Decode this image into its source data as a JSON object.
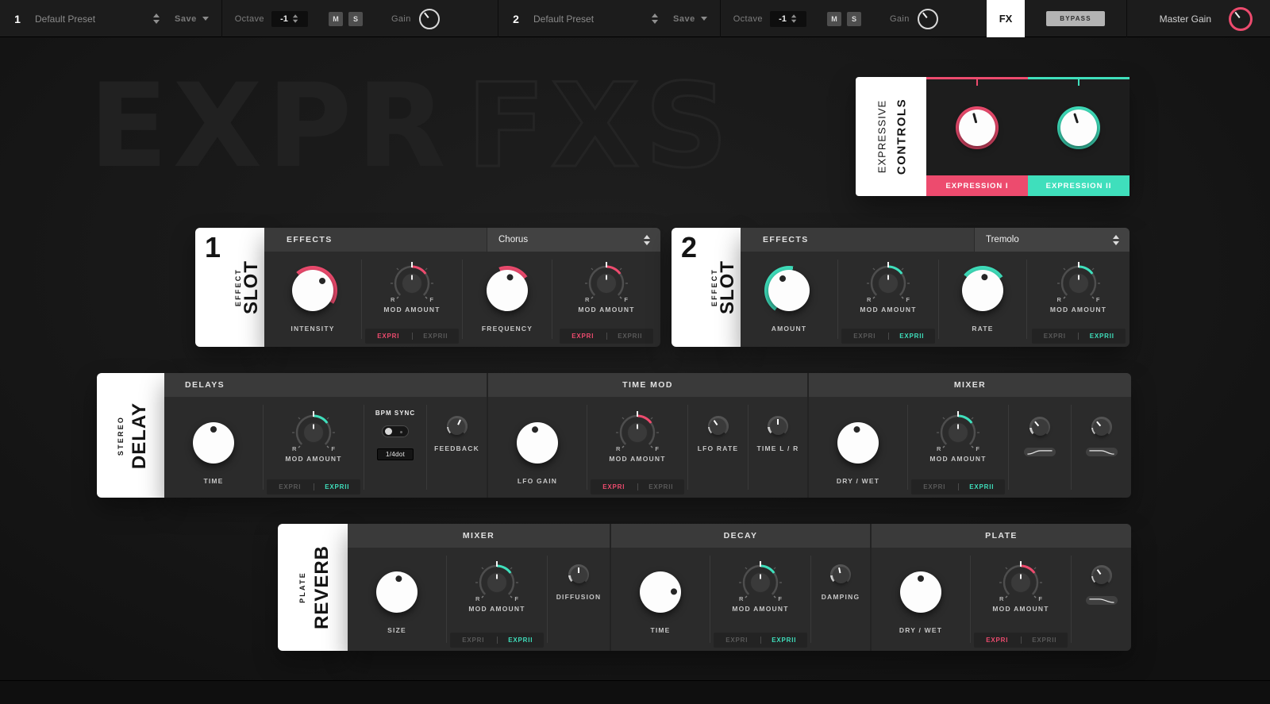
{
  "colors": {
    "pink": "#ED4B6E",
    "teal": "#3FDFBC"
  },
  "topbar": {
    "ch1": {
      "index": "1",
      "preset": "Default Preset",
      "save": "Save",
      "octave": "Octave",
      "octave_value": "-1",
      "mute": "M",
      "solo": "S",
      "gain": "Gain"
    },
    "ch2": {
      "index": "2",
      "preset": "Default Preset",
      "save": "Save",
      "octave": "Octave",
      "octave_value": "-1",
      "mute": "M",
      "solo": "S",
      "gain": "Gain"
    },
    "fx_tab": "FX",
    "bypass": "BYPASS",
    "master_gain": "Master Gain"
  },
  "watermark": {
    "solid": "EXPR",
    "outline": "FXS"
  },
  "expressive": {
    "title_thin": "EXPRESSIVE",
    "title_bold": "CONTROLS",
    "banner_i": "EXPRESSION I",
    "banner_ii": "EXPRESSION II"
  },
  "shared": {
    "effects_header": "EFFECTS",
    "mod_amount": "MOD AMOUNT",
    "r": "R",
    "f": "F",
    "expr_i": "EXPRI",
    "expr_ii": "EXPRII"
  },
  "slot1": {
    "number": "1",
    "side_thin": "EFFECT",
    "side_bold": "SLOT",
    "effect": "Chorus",
    "knob_a": "INTENSITY",
    "knob_b": "FREQUENCY"
  },
  "slot2": {
    "number": "2",
    "side_thin": "EFFECT",
    "side_bold": "SLOT",
    "effect": "Tremolo",
    "knob_a": "AMOUNT",
    "knob_b": "RATE"
  },
  "delay": {
    "side_thin": "STEREO",
    "side_bold": "DELAY",
    "h_delays": "DELAYS",
    "h_timemod": "TIME MOD",
    "h_mixer": "MIXER",
    "time": "TIME",
    "bpm_sync": "BPM SYNC",
    "sync_value": "1/4dot",
    "feedback": "FEEDBACK",
    "lfo_gain": "LFO GAIN",
    "lfo_rate": "LFO RATE",
    "time_lr": "TIME L / R",
    "dry_wet": "DRY / WET"
  },
  "reverb": {
    "side_thin": "PLATE",
    "side_bold": "REVERB",
    "h_mixer": "MIXER",
    "h_decay": "DECAY",
    "h_plate": "PLATE",
    "size": "SIZE",
    "diffusion": "DIFFUSION",
    "time": "TIME",
    "damping": "DAMPING",
    "dry_wet": "DRY / WET"
  }
}
